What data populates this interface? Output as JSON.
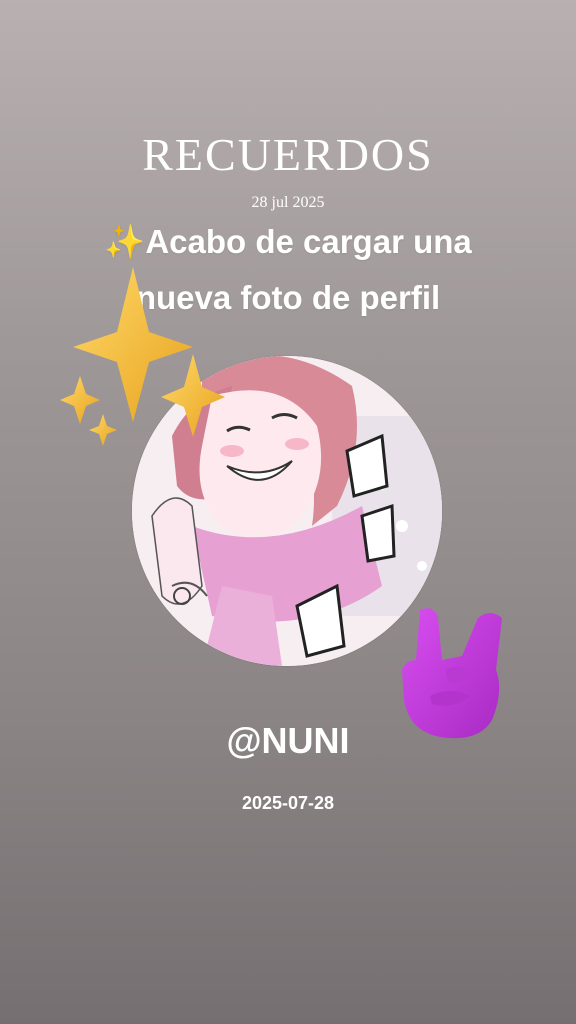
{
  "header": {
    "title": "RECUERDOS",
    "date": "28 jul 2025"
  },
  "caption": {
    "emoji": "✨",
    "line1": "Acabo de cargar una",
    "line2": "nueva foto de perfil"
  },
  "profile": {
    "username": "@NUNI",
    "date": "2025-07-28",
    "avatar_description_icon": "manga-girl-avatar"
  },
  "stickers": {
    "sparkles_icon": "sparkles-icon",
    "rock_hand_icon": "rock-on-hand-icon"
  },
  "colors": {
    "text": "#ffffff",
    "sparkle_gold": "#f3b62e",
    "hand_purple": "#c93bd9",
    "avatar_pink": "#e8a6c6"
  }
}
